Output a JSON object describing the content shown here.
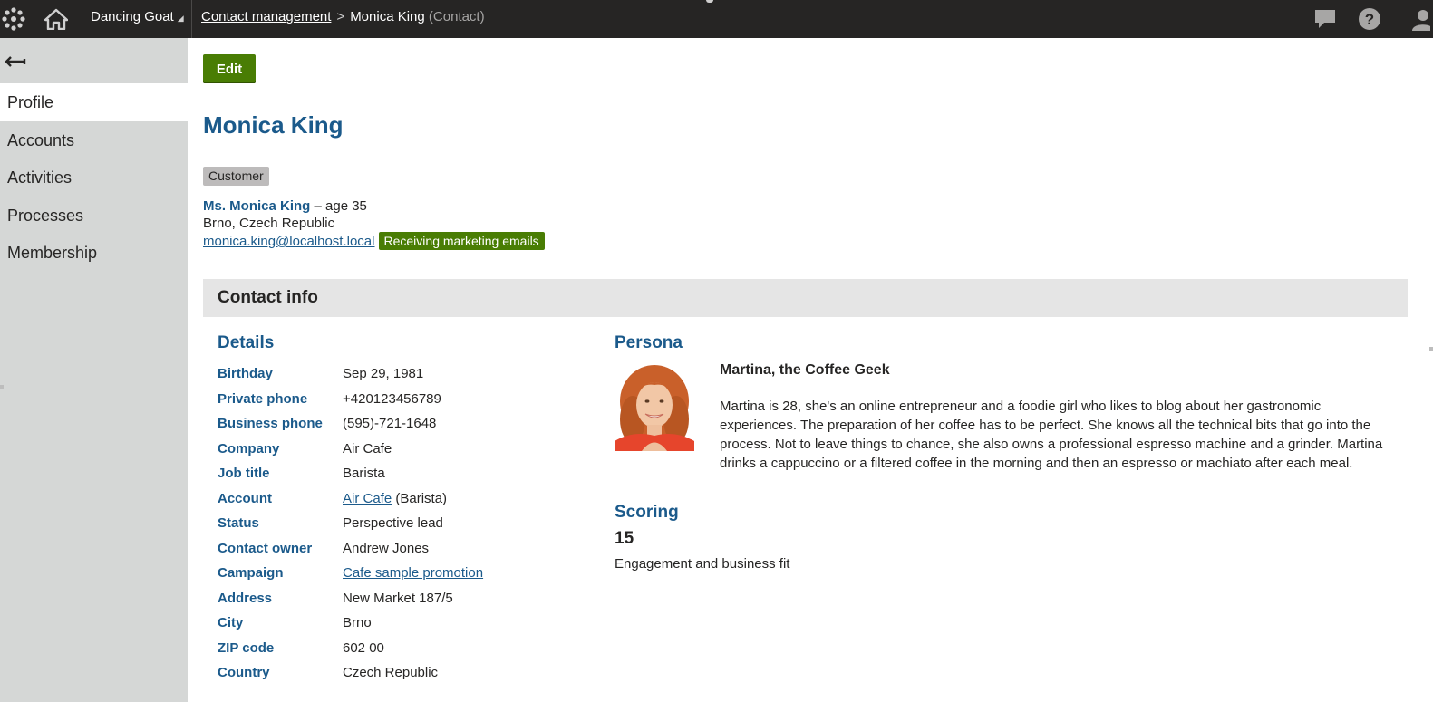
{
  "topbar": {
    "site": "Dancing Goat",
    "breadcrumb_link": "Contact management",
    "breadcrumb_separator": ">",
    "current": "Monica King",
    "current_type": "(Contact)"
  },
  "sidebar": {
    "items": [
      {
        "label": "Profile"
      },
      {
        "label": "Accounts"
      },
      {
        "label": "Activities"
      },
      {
        "label": "Processes"
      },
      {
        "label": "Membership"
      }
    ]
  },
  "main": {
    "edit_label": "Edit",
    "title": "Monica King",
    "tag": "Customer",
    "full_name": "Ms. Monica King",
    "age_text": " – age 35",
    "location": "Brno, Czech Republic",
    "email": "monica.king@localhost.local",
    "email_badge": "Receiving marketing emails",
    "section_title": "Contact info",
    "details_title": "Details",
    "details": [
      {
        "label": "Birthday",
        "value": "Sep 29, 1981"
      },
      {
        "label": "Private phone",
        "value": "+420123456789"
      },
      {
        "label": "Business phone",
        "value": "(595)-721-1648"
      },
      {
        "label": "Company",
        "value": "Air Cafe"
      },
      {
        "label": "Job title",
        "value": "Barista"
      },
      {
        "label": "Account",
        "link": "Air Cafe",
        "suffix": " (Barista)"
      },
      {
        "label": "Status",
        "value": "Perspective lead"
      },
      {
        "label": "Contact owner",
        "value": "Andrew Jones"
      },
      {
        "label": "Campaign",
        "link": "Cafe sample promotion"
      },
      {
        "label": "Address",
        "value": "New Market 187/5"
      },
      {
        "label": "City",
        "value": "Brno"
      },
      {
        "label": "ZIP code",
        "value": "602 00"
      },
      {
        "label": "Country",
        "value": "Czech Republic"
      }
    ],
    "persona_title": "Persona",
    "persona_name": "Martina, the Coffee Geek",
    "persona_description": "Martina is 28, she's an online entrepreneur and a foodie girl who likes to blog about her gastronomic experiences. The preparation of her coffee has to be perfect. She knows all the technical bits that go into the process. Not to leave things to chance, she also owns a professional espresso machine and a grinder.  Martina drinks a cappuccino or a filtered coffee in the morning and then an espresso or machiato after each meal.",
    "scoring_title": "Scoring",
    "score": "15",
    "score_label": "Engagement and business fit"
  },
  "colors": {
    "topbar": "#262524",
    "sidebar": "#d5d7d6",
    "accent_blue": "#1b5a8b",
    "green": "#497d04"
  }
}
